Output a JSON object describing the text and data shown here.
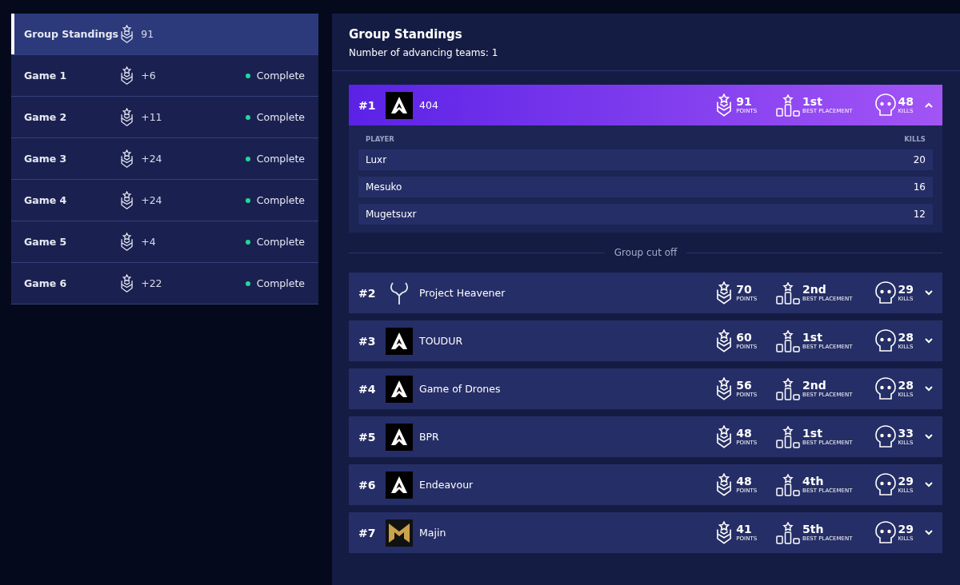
{
  "sidebar": {
    "items": [
      {
        "label": "Group Standings",
        "points": "91",
        "selected": true
      },
      {
        "label": "Game 1",
        "points": "+6",
        "status": "Complete",
        "selected": false
      },
      {
        "label": "Game 2",
        "points": "+11",
        "status": "Complete",
        "selected": false
      },
      {
        "label": "Game 3",
        "points": "+24",
        "status": "Complete",
        "selected": false
      },
      {
        "label": "Game 4",
        "points": "+24",
        "status": "Complete",
        "selected": false
      },
      {
        "label": "Game 5",
        "points": "+4",
        "status": "Complete",
        "selected": false
      },
      {
        "label": "Game 6",
        "points": "+22",
        "status": "Complete",
        "selected": false
      }
    ]
  },
  "main": {
    "title": "Group Standings",
    "subtitle": "Number of advancing teams: 1",
    "advancing_teams": [
      {
        "rank": "#1",
        "logo": {
          "kind": "apex"
        },
        "name": "404",
        "points": "91",
        "points_label": "POINTS",
        "placement": "1st",
        "placement_label": "BEST PLACEMENT",
        "kills": "48",
        "kills_label": "KILLS",
        "expanded": true,
        "player_header": "PLAYER",
        "kills_header": "KILLS",
        "players": [
          {
            "name": "Luxr",
            "kills": "20"
          },
          {
            "name": "Mesuko",
            "kills": "16"
          },
          {
            "name": "Mugetsuxr",
            "kills": "12"
          }
        ]
      }
    ],
    "cutoff_label": "Group cut off",
    "other_teams": [
      {
        "rank": "#2",
        "logo": {
          "kind": "wings"
        },
        "name": "Project Heavener",
        "points": "70",
        "points_label": "POINTS",
        "placement": "2nd",
        "placement_label": "BEST PLACEMENT",
        "kills": "29",
        "kills_label": "KILLS",
        "expanded": false
      },
      {
        "rank": "#3",
        "logo": {
          "kind": "apex"
        },
        "name": "TOUDUR",
        "points": "60",
        "points_label": "POINTS",
        "placement": "1st",
        "placement_label": "BEST PLACEMENT",
        "kills": "28",
        "kills_label": "KILLS",
        "expanded": false
      },
      {
        "rank": "#4",
        "logo": {
          "kind": "apex"
        },
        "name": "Game of Drones",
        "points": "56",
        "points_label": "POINTS",
        "placement": "2nd",
        "placement_label": "BEST PLACEMENT",
        "kills": "28",
        "kills_label": "KILLS",
        "expanded": false
      },
      {
        "rank": "#5",
        "logo": {
          "kind": "apex"
        },
        "name": "BPR",
        "points": "48",
        "points_label": "POINTS",
        "placement": "1st",
        "placement_label": "BEST PLACEMENT",
        "kills": "33",
        "kills_label": "KILLS",
        "expanded": false
      },
      {
        "rank": "#6",
        "logo": {
          "kind": "apex"
        },
        "name": "Endeavour",
        "points": "48",
        "points_label": "POINTS",
        "placement": "4th",
        "placement_label": "BEST PLACEMENT",
        "kills": "29",
        "kills_label": "KILLS",
        "expanded": false
      },
      {
        "rank": "#7",
        "logo": {
          "kind": "gold"
        },
        "name": "Majin",
        "points": "41",
        "points_label": "POINTS",
        "placement": "5th",
        "placement_label": "BEST PLACEMENT",
        "kills": "29",
        "kills_label": "KILLS",
        "expanded": false
      }
    ]
  }
}
